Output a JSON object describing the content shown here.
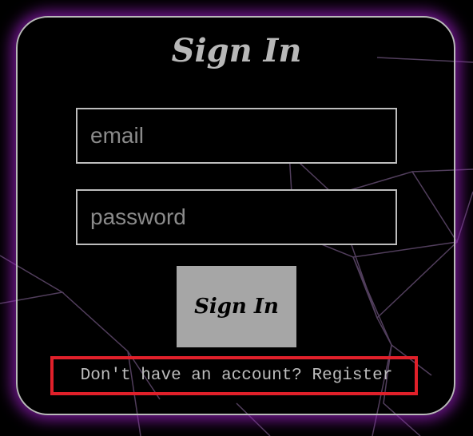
{
  "form": {
    "title": "Sign In",
    "email_placeholder": "email",
    "password_placeholder": "password",
    "submit_label": "Sign In",
    "register_prompt": "Don't have an account? Register"
  },
  "colors": {
    "background": "#000000",
    "card_border": "#b9b9b9",
    "card_glow": "#9a1ec0",
    "title_text": "#b8b8b8",
    "button_bg": "#a6a6a6",
    "highlight_box": "#e0202a"
  }
}
